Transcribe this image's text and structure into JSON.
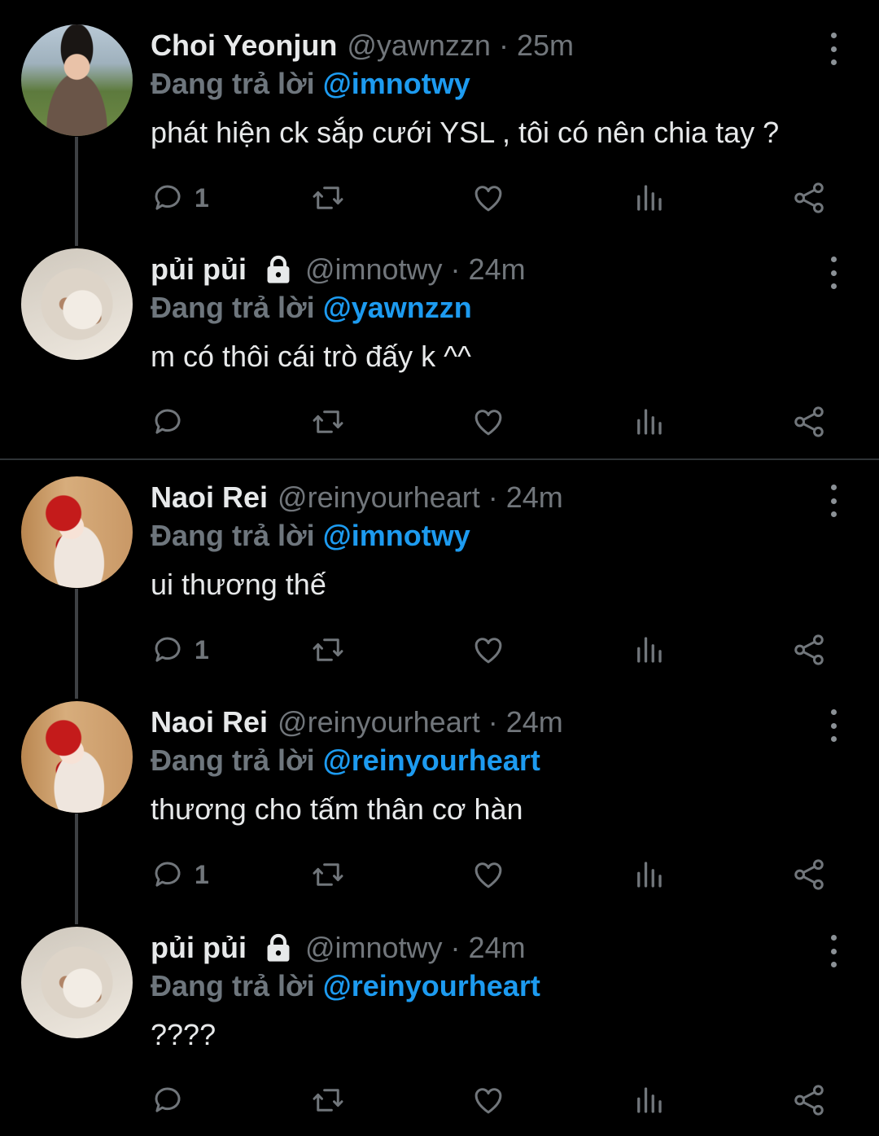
{
  "reply_prefix": "Đang trả lời",
  "tweets": [
    {
      "name": "Choi Yeonjun",
      "handle": "@yawnzzn",
      "time": "25m",
      "locked": false,
      "reply_to": "@imnotwy",
      "text": "phát hiện ck sắp cưới YSL , tôi có nên chia tay ?",
      "reply_count": "1",
      "avatar": "man-in-park"
    },
    {
      "name": "pủi pủi",
      "handle": "@imnotwy",
      "time": "24m",
      "locked": true,
      "reply_to": "@yawnzzn",
      "text": "m có thôi cái trò đấy k ^^",
      "reply_count": "",
      "avatar": "bunny"
    },
    {
      "name": "Naoi Rei",
      "handle": "@reinyourheart",
      "time": "24m",
      "locked": false,
      "reply_to": "@imnotwy",
      "text": "ui thương thế",
      "reply_count": "1",
      "avatar": "girl-red-hat"
    },
    {
      "name": "Naoi Rei",
      "handle": "@reinyourheart",
      "time": "24m",
      "locked": false,
      "reply_to": "@reinyourheart",
      "text": "thương cho tấm thân cơ hàn",
      "reply_count": "1",
      "avatar": "girl-red-hat"
    },
    {
      "name": "pủi pủi",
      "handle": "@imnotwy",
      "time": "24m",
      "locked": true,
      "reply_to": "@reinyourheart",
      "text": "????",
      "reply_count": "",
      "avatar": "bunny"
    }
  ],
  "colors": {
    "background": "#000000",
    "text": "#e7e9ea",
    "muted": "#71767b",
    "link": "#1d9bf0",
    "thread_line": "#3e4144"
  },
  "icons": [
    "reply-icon",
    "retweet-icon",
    "like-icon",
    "stats-icon",
    "share-icon",
    "lock-icon",
    "more-icon"
  ]
}
